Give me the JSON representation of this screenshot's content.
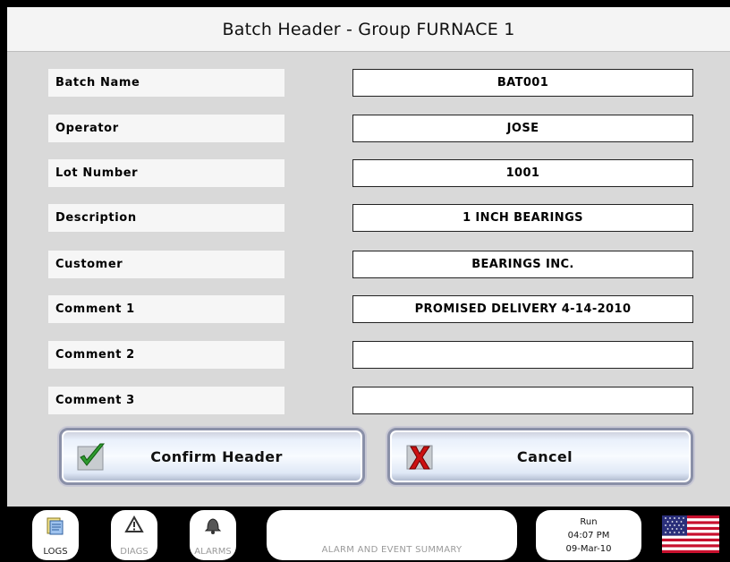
{
  "header": {
    "title": "Batch Header - Group FURNACE 1"
  },
  "fields": [
    {
      "label": "Batch Name",
      "value": "BAT001"
    },
    {
      "label": "Operator",
      "value": "JOSE"
    },
    {
      "label": "Lot Number",
      "value": "1001"
    },
    {
      "label": "Description",
      "value": "1 INCH BEARINGS"
    },
    {
      "label": "Customer",
      "value": "BEARINGS INC."
    },
    {
      "label": "Comment 1",
      "value": "PROMISED DELIVERY 4-14-2010"
    },
    {
      "label": "Comment 2",
      "value": ""
    },
    {
      "label": "Comment 3",
      "value": ""
    }
  ],
  "actions": {
    "confirm_label": "Confirm Header",
    "confirm_icon": "green-checkmark-icon",
    "cancel_label": "Cancel",
    "cancel_icon": "red-x-icon"
  },
  "footer": {
    "logs_label": "LOGS",
    "diags_label": "DIAGS",
    "alarms_label": "ALARMS",
    "summary_label": "ALARM AND EVENT SUMMARY",
    "status_mode": "Run",
    "status_time": "04:07 PM",
    "status_date": "09-Mar-10",
    "flag_icon": "us-flag-icon"
  },
  "colors": {
    "panel_bg": "#d9d9d9",
    "confirm_icon": "#2e9a2e",
    "cancel_icon": "#cc1111"
  }
}
